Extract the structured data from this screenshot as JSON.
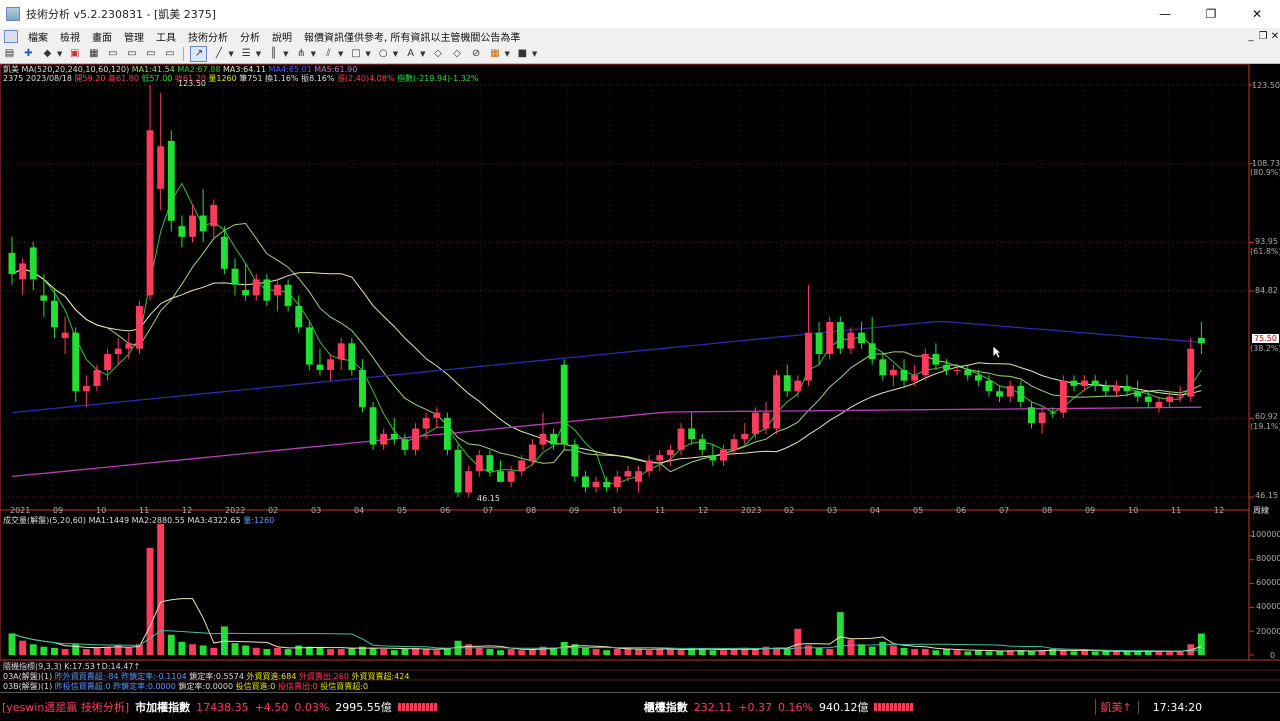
{
  "window": {
    "title": "技術分析 v5.2.230831 - [凱美 2375]",
    "controls": [
      "—",
      "❐",
      "✕"
    ]
  },
  "menu": {
    "items": [
      "檔案",
      "檢視",
      "畫面",
      "管理",
      "工具",
      "技術分析",
      "分析",
      "說明"
    ],
    "notice": "報價資訊僅供參考, 所有資訊以主管機關公告為準",
    "mdi_controls": [
      "_",
      "❐",
      "✕"
    ]
  },
  "price_panel": {
    "stock_name": "凱美",
    "ma_label": "MA(520,20,240,10,60,120)",
    "ma1": "MA1:41.54",
    "ma2": "MA2:67.88",
    "ma3": "MA3:64.11",
    "ma4": "MA4:65.01",
    "ma5": "MA5:61.90",
    "code": "2375",
    "date": "2023/08/18",
    "open": "開59.20",
    "high": "高61.80",
    "low": "低57.00",
    "close": "收61.20",
    "volume": "量1260",
    "trades": "筆751",
    "turnover": "換1.16%",
    "amplitude": "振8.16%",
    "change": "漲(2.40)4.08%",
    "index": "指數(-219.94)-1.32%",
    "high_marker": "123.50",
    "low_marker": "46.15",
    "current_tag": "75.50",
    "current_pct": "(38.2%)",
    "y_labels": [
      {
        "v": "123.50",
        "p": ""
      },
      {
        "v": "108.73",
        "p": "(80.9%)"
      },
      {
        "v": "93.95",
        "p": "(61.8%)"
      },
      {
        "v": "84.82",
        "p": ""
      },
      {
        "v": "60.92",
        "p": "(19.1%)"
      },
      {
        "v": "46.15",
        "p": ""
      }
    ],
    "x_labels": [
      "2021",
      "09",
      "10",
      "11",
      "12",
      "2022",
      "02",
      "03",
      "04",
      "05",
      "06",
      "07",
      "08",
      "09",
      "10",
      "11",
      "12",
      "2023",
      "02",
      "03",
      "04",
      "05",
      "06",
      "07",
      "08",
      "09",
      "10",
      "11",
      "12"
    ],
    "period": "周線"
  },
  "volume_panel": {
    "label": "成交量(解盤)(5,20,60)",
    "ma1": "MA1:1449",
    "ma2": "MA2:2880.55",
    "ma3": "MA3:4322.65",
    "vol": "量:1260",
    "y_labels": [
      "100000",
      "80000",
      "60000",
      "40000",
      "20000",
      "0"
    ]
  },
  "indicator_panel": {
    "line1": "隨機指標(9,3,3) K:17.53↑D:14.47↑",
    "line2_parts": [
      "03A(解盤)(1)",
      "昨外資買賣超:-84",
      "昨鎖定率:-0.1104",
      "鎖定率:0.5574",
      "外資買進:684",
      "外資賣出:260",
      "外資買賣超:424"
    ],
    "line3_parts": [
      "03B(解盤)(1)",
      "昨投信買賣超:0",
      "昨鎖定率:0.0000",
      "鎖定率:0.0000",
      "投信買進:0",
      "投信賣出:0",
      "投信買賣超:0"
    ]
  },
  "statusbar": {
    "brand": "[yeswin邁是贏 技術分析]",
    "index_name": "市加權指數",
    "index_value": "17438.35",
    "index_change": "+4.50",
    "index_pct": "0.03%",
    "index_amount": "2995.55億",
    "otc_name": "櫃檯指數",
    "otc_value": "232.11",
    "otc_change": "+0.37",
    "otc_pct": "0.16%",
    "otc_amount": "940.12億",
    "ticker": "凱美↑",
    "time": "17:34:20"
  },
  "colors": {
    "up": "#ff3b5c",
    "down": "#22e033",
    "ma1": "#9bd47a",
    "ma2": "#3fbf3f",
    "ma3": "#e6e6b4",
    "ma4": "#2a2aaa",
    "ma5": "#b83cb8"
  },
  "chart_data": {
    "type": "candlestick",
    "price_axis": {
      "min": 46.15,
      "max": 123.5
    },
    "candles": [
      {
        "o": 92,
        "h": 95,
        "l": 86,
        "c": 88,
        "up": false
      },
      {
        "o": 87,
        "h": 91,
        "l": 84,
        "c": 90,
        "up": true
      },
      {
        "o": 93,
        "h": 94,
        "l": 85,
        "c": 87,
        "up": false
      },
      {
        "o": 84,
        "h": 88,
        "l": 80,
        "c": 83,
        "up": false
      },
      {
        "o": 83,
        "h": 85,
        "l": 76,
        "c": 78,
        "up": false
      },
      {
        "o": 76,
        "h": 80,
        "l": 73,
        "c": 77,
        "up": true
      },
      {
        "o": 77,
        "h": 78,
        "l": 64,
        "c": 66,
        "up": false
      },
      {
        "o": 66,
        "h": 69,
        "l": 63,
        "c": 67,
        "up": true
      },
      {
        "o": 67,
        "h": 71,
        "l": 66,
        "c": 70,
        "up": true
      },
      {
        "o": 70,
        "h": 74,
        "l": 68,
        "c": 73,
        "up": true
      },
      {
        "o": 73,
        "h": 76,
        "l": 71,
        "c": 74,
        "up": true
      },
      {
        "o": 74,
        "h": 77,
        "l": 72,
        "c": 75,
        "up": true
      },
      {
        "o": 74,
        "h": 83,
        "l": 73,
        "c": 82,
        "up": true
      },
      {
        "o": 84,
        "h": 123.5,
        "l": 83,
        "c": 115,
        "up": true
      },
      {
        "o": 104,
        "h": 122,
        "l": 100,
        "c": 112,
        "up": true
      },
      {
        "o": 113,
        "h": 115,
        "l": 96,
        "c": 98,
        "up": false
      },
      {
        "o": 97,
        "h": 99,
        "l": 93,
        "c": 95,
        "up": false
      },
      {
        "o": 95,
        "h": 101,
        "l": 94,
        "c": 99,
        "up": true
      },
      {
        "o": 99,
        "h": 104,
        "l": 94,
        "c": 96,
        "up": false
      },
      {
        "o": 97,
        "h": 102,
        "l": 95,
        "c": 101,
        "up": true
      },
      {
        "o": 95,
        "h": 97,
        "l": 88,
        "c": 89,
        "up": false
      },
      {
        "o": 89,
        "h": 91,
        "l": 84,
        "c": 86,
        "up": false
      },
      {
        "o": 85,
        "h": 90,
        "l": 83,
        "c": 84,
        "up": false
      },
      {
        "o": 84,
        "h": 88,
        "l": 83,
        "c": 87,
        "up": true
      },
      {
        "o": 87,
        "h": 88,
        "l": 82,
        "c": 83,
        "up": false
      },
      {
        "o": 84,
        "h": 87,
        "l": 81,
        "c": 86,
        "up": true
      },
      {
        "o": 86,
        "h": 87,
        "l": 81,
        "c": 82,
        "up": false
      },
      {
        "o": 82,
        "h": 84,
        "l": 77,
        "c": 78,
        "up": false
      },
      {
        "o": 78,
        "h": 79,
        "l": 70,
        "c": 71,
        "up": false
      },
      {
        "o": 71,
        "h": 74,
        "l": 69,
        "c": 70,
        "up": false
      },
      {
        "o": 70,
        "h": 73,
        "l": 68,
        "c": 72,
        "up": true
      },
      {
        "o": 72,
        "h": 76,
        "l": 70,
        "c": 75,
        "up": true
      },
      {
        "o": 75,
        "h": 76,
        "l": 69,
        "c": 70,
        "up": false
      },
      {
        "o": 70,
        "h": 72,
        "l": 62,
        "c": 63,
        "up": false
      },
      {
        "o": 63,
        "h": 64,
        "l": 55,
        "c": 56,
        "up": false
      },
      {
        "o": 56,
        "h": 59,
        "l": 55,
        "c": 58,
        "up": true
      },
      {
        "o": 58,
        "h": 61,
        "l": 56,
        "c": 57,
        "up": false
      },
      {
        "o": 57,
        "h": 58,
        "l": 54,
        "c": 55,
        "up": false
      },
      {
        "o": 55,
        "h": 60,
        "l": 54,
        "c": 59,
        "up": true
      },
      {
        "o": 59,
        "h": 62,
        "l": 57,
        "c": 61,
        "up": true
      },
      {
        "o": 61,
        "h": 63,
        "l": 59,
        "c": 62,
        "up": true
      },
      {
        "o": 61,
        "h": 62,
        "l": 54,
        "c": 55,
        "up": false
      },
      {
        "o": 55,
        "h": 56,
        "l": 46.15,
        "c": 47,
        "up": false
      },
      {
        "o": 47,
        "h": 52,
        "l": 46.15,
        "c": 51,
        "up": true
      },
      {
        "o": 51,
        "h": 55,
        "l": 50,
        "c": 54,
        "up": true
      },
      {
        "o": 54,
        "h": 55,
        "l": 50,
        "c": 51,
        "up": false
      },
      {
        "o": 51,
        "h": 53,
        "l": 49,
        "c": 49,
        "up": false
      },
      {
        "o": 49,
        "h": 52,
        "l": 48,
        "c": 51,
        "up": true
      },
      {
        "o": 51,
        "h": 54,
        "l": 50,
        "c": 53,
        "up": true
      },
      {
        "o": 53,
        "h": 57,
        "l": 52,
        "c": 56,
        "up": true
      },
      {
        "o": 56,
        "h": 62,
        "l": 55,
        "c": 58,
        "up": true
      },
      {
        "o": 58,
        "h": 59,
        "l": 55,
        "c": 56,
        "up": false
      },
      {
        "o": 56,
        "h": 72,
        "l": 55,
        "c": 71,
        "up": false
      },
      {
        "o": 56,
        "h": 57,
        "l": 49,
        "c": 50,
        "up": false
      },
      {
        "o": 50,
        "h": 51,
        "l": 47,
        "c": 48,
        "up": false
      },
      {
        "o": 48,
        "h": 50,
        "l": 47,
        "c": 49,
        "up": true
      },
      {
        "o": 49,
        "h": 50,
        "l": 47,
        "c": 48,
        "up": false
      },
      {
        "o": 48,
        "h": 51,
        "l": 47,
        "c": 50,
        "up": true
      },
      {
        "o": 50,
        "h": 52,
        "l": 49,
        "c": 51,
        "up": true
      },
      {
        "o": 49,
        "h": 52,
        "l": 47,
        "c": 51,
        "up": true
      },
      {
        "o": 51,
        "h": 54,
        "l": 50,
        "c": 53,
        "up": true
      },
      {
        "o": 53,
        "h": 55,
        "l": 51,
        "c": 54,
        "up": true
      },
      {
        "o": 54,
        "h": 56,
        "l": 52,
        "c": 55,
        "up": true
      },
      {
        "o": 55,
        "h": 60,
        "l": 54,
        "c": 59,
        "up": true
      },
      {
        "o": 59,
        "h": 62,
        "l": 56,
        "c": 57,
        "up": false
      },
      {
        "o": 57,
        "h": 58,
        "l": 54,
        "c": 55,
        "up": false
      },
      {
        "o": 54,
        "h": 56,
        "l": 52,
        "c": 53,
        "up": false
      },
      {
        "o": 53,
        "h": 56,
        "l": 52,
        "c": 55,
        "up": true
      },
      {
        "o": 55,
        "h": 58,
        "l": 54,
        "c": 57,
        "up": true
      },
      {
        "o": 57,
        "h": 60,
        "l": 56,
        "c": 58,
        "up": true
      },
      {
        "o": 58,
        "h": 63,
        "l": 57,
        "c": 62,
        "up": true
      },
      {
        "o": 62,
        "h": 64,
        "l": 58,
        "c": 59,
        "up": true
      },
      {
        "o": 59,
        "h": 70,
        "l": 58,
        "c": 69,
        "up": true
      },
      {
        "o": 69,
        "h": 71,
        "l": 65,
        "c": 66,
        "up": false
      },
      {
        "o": 66,
        "h": 69,
        "l": 65,
        "c": 68,
        "up": true
      },
      {
        "o": 68,
        "h": 86,
        "l": 67,
        "c": 77,
        "up": true
      },
      {
        "o": 77,
        "h": 79,
        "l": 71,
        "c": 73,
        "up": false
      },
      {
        "o": 73,
        "h": 80,
        "l": 72,
        "c": 79,
        "up": true
      },
      {
        "o": 79,
        "h": 80,
        "l": 73,
        "c": 74,
        "up": false
      },
      {
        "o": 74,
        "h": 78,
        "l": 73,
        "c": 77,
        "up": true
      },
      {
        "o": 77,
        "h": 79,
        "l": 74,
        "c": 75,
        "up": false
      },
      {
        "o": 75,
        "h": 80,
        "l": 71,
        "c": 72,
        "up": false
      },
      {
        "o": 72,
        "h": 73,
        "l": 68,
        "c": 69,
        "up": false
      },
      {
        "o": 69,
        "h": 71,
        "l": 67,
        "c": 70,
        "up": true
      },
      {
        "o": 70,
        "h": 72,
        "l": 67,
        "c": 68,
        "up": false
      },
      {
        "o": 68,
        "h": 71,
        "l": 67,
        "c": 69,
        "up": true
      },
      {
        "o": 69,
        "h": 74,
        "l": 68,
        "c": 73,
        "up": true
      },
      {
        "o": 73,
        "h": 75,
        "l": 70,
        "c": 71,
        "up": false
      },
      {
        "o": 71,
        "h": 72,
        "l": 69,
        "c": 70,
        "up": false
      },
      {
        "o": 70,
        "h": 71,
        "l": 69,
        "c": 70,
        "up": true
      },
      {
        "o": 70,
        "h": 71,
        "l": 68,
        "c": 69,
        "up": false
      },
      {
        "o": 69,
        "h": 70,
        "l": 67,
        "c": 68,
        "up": false
      },
      {
        "o": 68,
        "h": 69,
        "l": 65,
        "c": 66,
        "up": false
      },
      {
        "o": 66,
        "h": 67,
        "l": 64,
        "c": 65,
        "up": false
      },
      {
        "o": 65,
        "h": 68,
        "l": 64,
        "c": 67,
        "up": true
      },
      {
        "o": 67,
        "h": 68,
        "l": 63,
        "c": 64,
        "up": false
      },
      {
        "o": 63,
        "h": 64,
        "l": 59,
        "c": 60,
        "up": false
      },
      {
        "o": 60,
        "h": 63,
        "l": 58,
        "c": 62,
        "up": true
      },
      {
        "o": 62,
        "h": 63,
        "l": 61,
        "c": 62,
        "up": false
      },
      {
        "o": 62,
        "h": 69,
        "l": 61,
        "c": 68,
        "up": true
      },
      {
        "o": 68,
        "h": 69,
        "l": 66,
        "c": 67,
        "up": false
      },
      {
        "o": 67,
        "h": 69,
        "l": 66,
        "c": 68,
        "up": true
      },
      {
        "o": 68,
        "h": 69,
        "l": 66,
        "c": 67,
        "up": false
      },
      {
        "o": 67,
        "h": 68,
        "l": 65,
        "c": 66,
        "up": false
      },
      {
        "o": 66,
        "h": 68,
        "l": 65,
        "c": 67,
        "up": true
      },
      {
        "o": 67,
        "h": 69,
        "l": 65,
        "c": 66,
        "up": false
      },
      {
        "o": 66,
        "h": 68,
        "l": 64,
        "c": 65,
        "up": false
      },
      {
        "o": 65,
        "h": 66,
        "l": 63,
        "c": 64,
        "up": false
      },
      {
        "o": 63,
        "h": 65,
        "l": 62,
        "c": 64,
        "up": true
      },
      {
        "o": 64,
        "h": 66,
        "l": 63,
        "c": 65,
        "up": true
      },
      {
        "o": 65,
        "h": 67,
        "l": 64,
        "c": 65,
        "up": true
      },
      {
        "o": 65,
        "h": 76,
        "l": 64,
        "c": 74,
        "up": true
      },
      {
        "o": 75,
        "h": 79,
        "l": 73,
        "c": 76,
        "up": false
      }
    ],
    "volume_axis": {
      "min": 0,
      "max": 110000
    },
    "volumes": [
      18000,
      12000,
      9000,
      7000,
      6000,
      5000,
      9000,
      5000,
      6000,
      7000,
      8000,
      6000,
      9000,
      90000,
      110000,
      17000,
      11000,
      9000,
      8000,
      6000,
      24000,
      10000,
      8000,
      6000,
      5000,
      6000,
      5000,
      8000,
      7000,
      6000,
      5000,
      5000,
      6000,
      7000,
      6000,
      5000,
      4000,
      5000,
      6000,
      5000,
      4000,
      6000,
      12000,
      9000,
      6000,
      5000,
      4000,
      5000,
      4000,
      5000,
      7000,
      6000,
      11000,
      9000,
      6000,
      5000,
      4000,
      5000,
      6000,
      5000,
      4000,
      5000,
      5000,
      4000,
      6000,
      5000,
      4000,
      4000,
      5000,
      6000,
      5000,
      7000,
      6000,
      5000,
      22000,
      8000,
      6000,
      5000,
      36000,
      13000,
      9000,
      7000,
      11000,
      8000,
      6000,
      5000,
      5000,
      4000,
      5000,
      4000,
      3000,
      4000,
      3000,
      3000,
      4000,
      4000,
      3000,
      4000,
      5000,
      4000,
      3000,
      4000,
      3000,
      3000,
      3000,
      3000,
      3000,
      3000,
      3000,
      3000,
      3000,
      9000,
      18000
    ]
  }
}
